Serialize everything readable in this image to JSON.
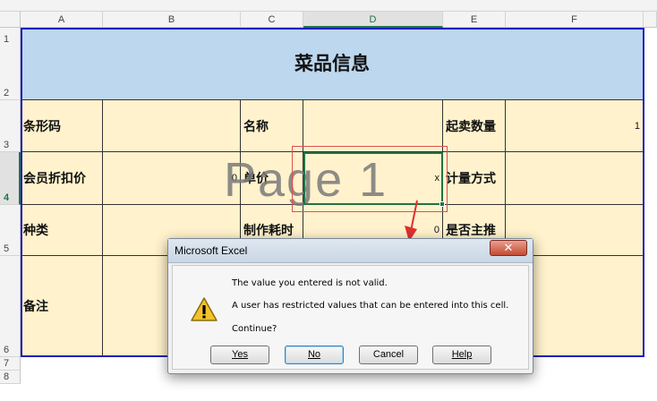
{
  "columns": [
    "A",
    "B",
    "C",
    "D",
    "E",
    "F"
  ],
  "rows": [
    "1",
    "2",
    "3",
    "4",
    "5",
    "6",
    "7",
    "8"
  ],
  "sheet": {
    "title": "菜品信息",
    "r3": {
      "a": "条形码",
      "c": "名称",
      "e": "起卖数量",
      "f": "1"
    },
    "r4": {
      "a": "会员折扣价",
      "b": "0",
      "c": "单价",
      "d": "x",
      "e": "计量方式"
    },
    "r5": {
      "a": "种类",
      "c": "制作耗时",
      "d": "0",
      "e": "是否主推"
    },
    "r6": {
      "a": "备注"
    },
    "watermark": "Page 1"
  },
  "dialog": {
    "title": "Microsoft Excel",
    "close": "✕",
    "message1": "The value you entered is not valid.",
    "message2": "A user has restricted values that can be entered into this cell.",
    "message3": "Continue?",
    "buttons": {
      "yes": "Yes",
      "no": "No",
      "cancel": "Cancel",
      "help": "Help"
    }
  },
  "colors": {
    "accent": "#217346",
    "title_fill": "#bdd7ee",
    "cell_fill": "#fff2cc",
    "table_border": "#1f1fbf"
  },
  "icons": {
    "dialog": "warning-icon"
  }
}
